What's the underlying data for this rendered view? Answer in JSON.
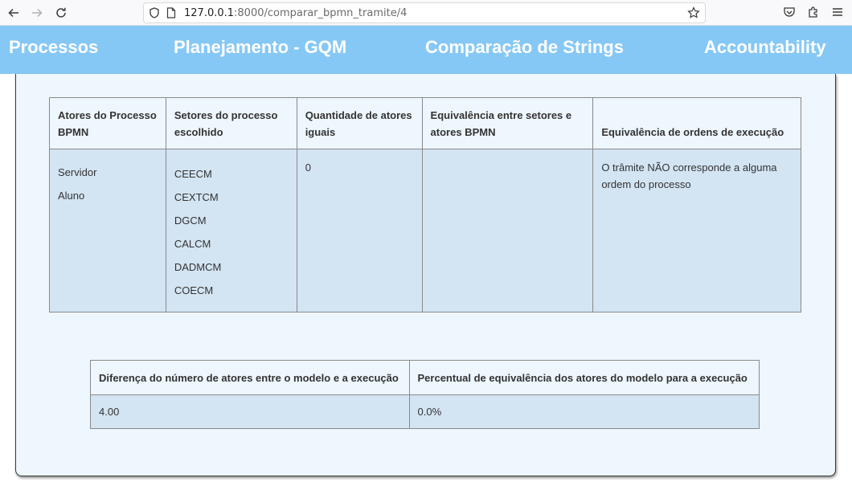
{
  "browser": {
    "url_host": "127.0.0.1",
    "url_rest": ":8000/comparar_bpmn_tramite/4"
  },
  "navbar": {
    "items": [
      {
        "label": "Processos"
      },
      {
        "label": "Planejamento - GQM"
      },
      {
        "label": "Comparação de Strings"
      },
      {
        "label": "Accountability"
      }
    ]
  },
  "comparison_table": {
    "headers": [
      "Atores do Processo BPMN",
      "Setores do processo escolhido",
      "Quantidade de atores iguais",
      "Equivalência entre setores e atores BPMN",
      "Equivalência de ordens de execução"
    ],
    "bpmn_actors": [
      "Servidor",
      "Aluno"
    ],
    "sectors": [
      "CEECM",
      "CEXTCM",
      "DGCM",
      "CALCM",
      "DADMCM",
      "COECM"
    ],
    "equal_actors_count": "0",
    "sector_actor_equivalence": "",
    "execution_order_equivalence": "O trâmite NÃO corresponde a alguma ordem do processo"
  },
  "summary_table": {
    "headers": [
      "Diferença do número de atores entre o modelo e a execução",
      "Percentual de equivalência dos atores do modelo para a execução"
    ],
    "actor_count_difference": "4.00",
    "equivalence_percentage": "0.0%"
  }
}
